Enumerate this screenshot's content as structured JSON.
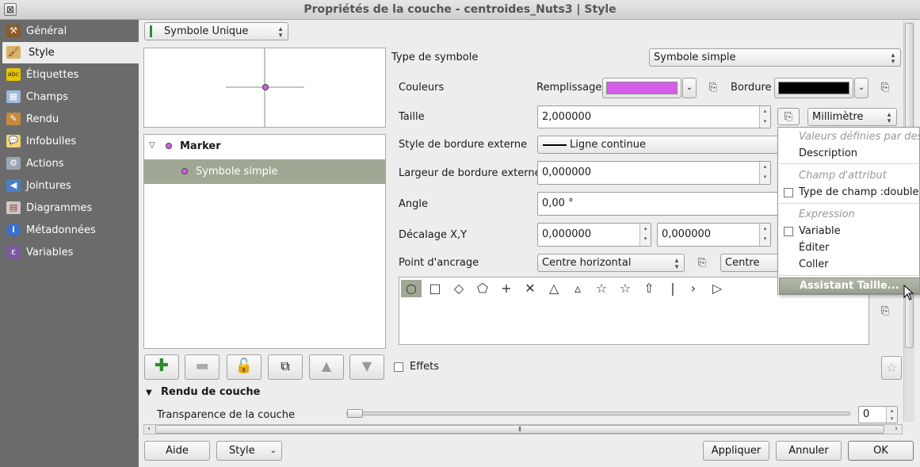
{
  "window": {
    "title": "Propriétés de la couche - centroides_Nuts3 | Style",
    "close_glyph": "⊠"
  },
  "sidebar": {
    "items": [
      {
        "label": "Général",
        "icon": "tools-icon",
        "color": "#8a5a2b",
        "glyph": "⚒"
      },
      {
        "label": "Style",
        "icon": "paint-icon",
        "color": "#d9b36a",
        "glyph": "🖌"
      },
      {
        "label": "Étiquettes",
        "icon": "labels-icon",
        "color": "#e6c400",
        "glyph": "abc"
      },
      {
        "label": "Champs",
        "icon": "table-icon",
        "color": "#a0b8d8",
        "glyph": "▦"
      },
      {
        "label": "Rendu",
        "icon": "brush-icon",
        "color": "#c48a3a",
        "glyph": "✎"
      },
      {
        "label": "Infobulles",
        "icon": "speech-bubble-icon",
        "color": "#f1d27a",
        "glyph": "💬"
      },
      {
        "label": "Actions",
        "icon": "gear-icon",
        "color": "#9aa6b5",
        "glyph": "⚙"
      },
      {
        "label": "Jointures",
        "icon": "join-icon",
        "color": "#4a7fc4",
        "glyph": "◀"
      },
      {
        "label": "Diagrammes",
        "icon": "chart-icon",
        "color": "#c9c9c9",
        "glyph": "▤"
      },
      {
        "label": "Métadonnées",
        "icon": "info-icon",
        "color": "#3b6fd1",
        "glyph": "i"
      },
      {
        "label": "Variables",
        "icon": "epsilon-icon",
        "color": "#7a5aa0",
        "glyph": "ε"
      }
    ],
    "active_index": 1
  },
  "renderer": {
    "selected": "Symbole Unique"
  },
  "tree": {
    "root": "Marker",
    "child": "Symbole simple"
  },
  "form": {
    "type_label": "Type de symbole",
    "type_value": "Symbole simple",
    "colors_label": "Couleurs",
    "fill_label": "Remplissage",
    "fill_color": "#d45ee8",
    "border_label": "Bordure",
    "border_color": "#000000",
    "size_label": "Taille",
    "size_value": "2,000000",
    "unit_value": "Millimètre",
    "outline_style_label": "Style de bordure externe",
    "outline_style_value": "Ligne continue",
    "outline_width_label": "Largeur de bordure externe",
    "outline_width_value": "0,000000",
    "angle_label": "Angle",
    "angle_value": "0,00 °",
    "offset_label": "Décalage X,Y",
    "offset_x": "0,000000",
    "offset_y": "0,000000",
    "anchor_label": "Point d'ancrage",
    "anchor_h": "Centre horizontal",
    "anchor_v": "Centre vert"
  },
  "shapes": [
    "○",
    "□",
    "◇",
    "⬠",
    "+",
    "✕",
    "△",
    "▵",
    "☆",
    "☆",
    "⇧",
    "|",
    "›",
    "▷"
  ],
  "menu": {
    "sec1": "Valeurs définies par des champs",
    "description": "Description",
    "sec2": "Champ d'attribut",
    "field_type": "Type de champ :double",
    "sec3": "Expression",
    "variable": "Variable",
    "edit": "Éditer",
    "paste": "Coller",
    "assistant": "Assistant Taille..."
  },
  "effects_label": "Effets",
  "layer_render": {
    "title": "Rendu de couche",
    "transparency_label": "Transparence de la couche",
    "transparency_value": "0"
  },
  "footer": {
    "help": "Aide",
    "style": "Style",
    "apply": "Appliquer",
    "cancel": "Annuler",
    "ok": "OK"
  }
}
